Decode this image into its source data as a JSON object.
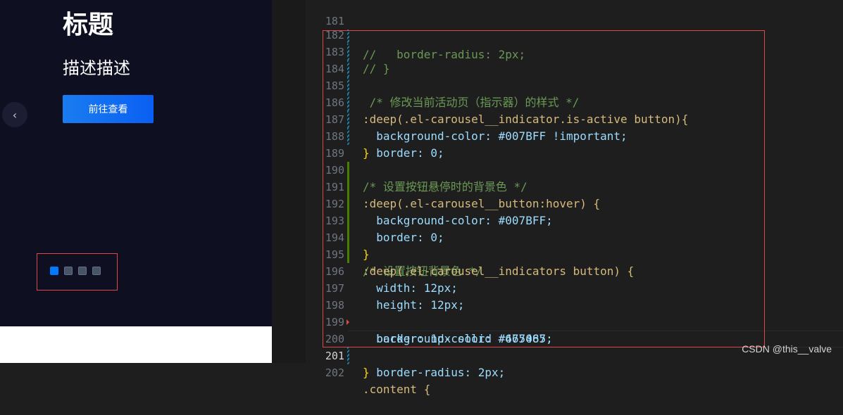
{
  "preview": {
    "title": "标题",
    "description": "描述描述",
    "button_label": "前往查看",
    "prev_arrow": "‹",
    "indicators": [
      {
        "active": true
      },
      {
        "active": false
      },
      {
        "active": false
      },
      {
        "active": false
      }
    ]
  },
  "editor": {
    "lines": [
      {
        "num": "181",
        "text": "//   border-radius: 2px;"
      },
      {
        "num": "182",
        "text": "// }"
      },
      {
        "num": "183",
        "text": ""
      },
      {
        "num": "184",
        "text": " /* 修改当前活动页（指示器）的样式 */"
      },
      {
        "num": "185",
        "text": ":deep(.el-carousel__indicator.is-active button){"
      },
      {
        "num": "186",
        "text": "  background-color: #007BFF !important;"
      },
      {
        "num": "187",
        "text": "  border: 0;"
      },
      {
        "num": "188",
        "text": "}"
      },
      {
        "num": "189",
        "text": "/* 设置按钮悬停时的背景色 */"
      },
      {
        "num": "190",
        "text": ":deep(.el-carousel__button:hover) {"
      },
      {
        "num": "191",
        "text": "  background-color: #007BFF;"
      },
      {
        "num": "192",
        "text": "  border: 0;"
      },
      {
        "num": "193",
        "text": "}"
      },
      {
        "num": "194",
        "text": "/* 设置按钮背景色 */"
      },
      {
        "num": "195",
        "text": ":deep(.el-carousel__indicators button) {"
      },
      {
        "num": "196",
        "text": "  width: 12px;"
      },
      {
        "num": "197",
        "text": "  height: 12px;"
      },
      {
        "num": "198",
        "text": "  background-color: #475467;"
      },
      {
        "num": "199",
        "text": "  border: 1px solid #667085;"
      },
      {
        "num": "200",
        "text": "  border-radius: 2px;"
      },
      {
        "num": "201",
        "text": "}"
      },
      {
        "num": "202",
        "text": ".content {"
      }
    ]
  },
  "watermark": "CSDN @this__valve",
  "colors": {
    "accent": "#007BFF",
    "indicator_bg": "#475467",
    "indicator_border": "#667085",
    "annotation": "#e04848"
  }
}
